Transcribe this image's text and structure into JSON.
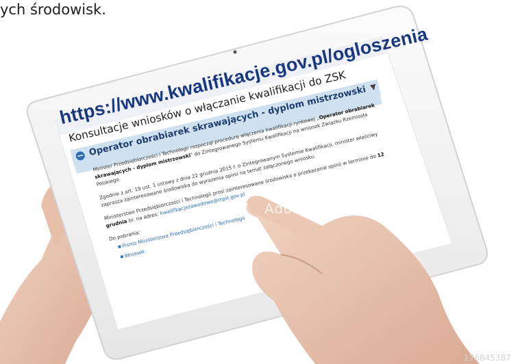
{
  "caption": "ych środowisk.",
  "screen": {
    "url": "https://www.kwalifikacje.gov.pl/ogloszenia",
    "page_title": "Konsultacje wniosków o włączanie kwalifikacji do ZSK",
    "accordion_title": "Operator obrabiarek skrawających - dyplom mistrzowski",
    "para1_a": "Minister Przedsiębiorczości i Technologii rozpoczął procedurę włączenia kwalifikacji rynkowej „",
    "para1_b": "Operator obrabiarek skrawających - dyplom mistrzowski",
    "para1_c": "\" do Zintegrowanego Systemu Kwalifikacji na wniosek Związku Rzemiosła Polskiego.",
    "para2_a": "Zgodnie z art. 19 ust. 1 ustawy z dnia 22 grudnia 2015 r. o Zintegrowanym Systemie Kwalifikacji, minister właściwy zaprasza zainteresowane środowiska do wyrażenia opinii na temat załączonego wniosku.",
    "para3_a": "Ministerstwo Przedsiębiorczości i Technologii prosi zainteresowane środowiska o przekazanie opinii w terminie do ",
    "para3_b": "12 grudnia",
    "para3_c": " br. na adres: ",
    "para3_link": "kwalifikacjezawodowe@mpit.gov.pl",
    "downloads_label": "Do pobrania:",
    "downloads": [
      "Pismo Ministerstwa Przedsiębiorczości i Technologii",
      "Wniosek"
    ]
  },
  "watermark": "Adobe",
  "stock_id": "176845387"
}
